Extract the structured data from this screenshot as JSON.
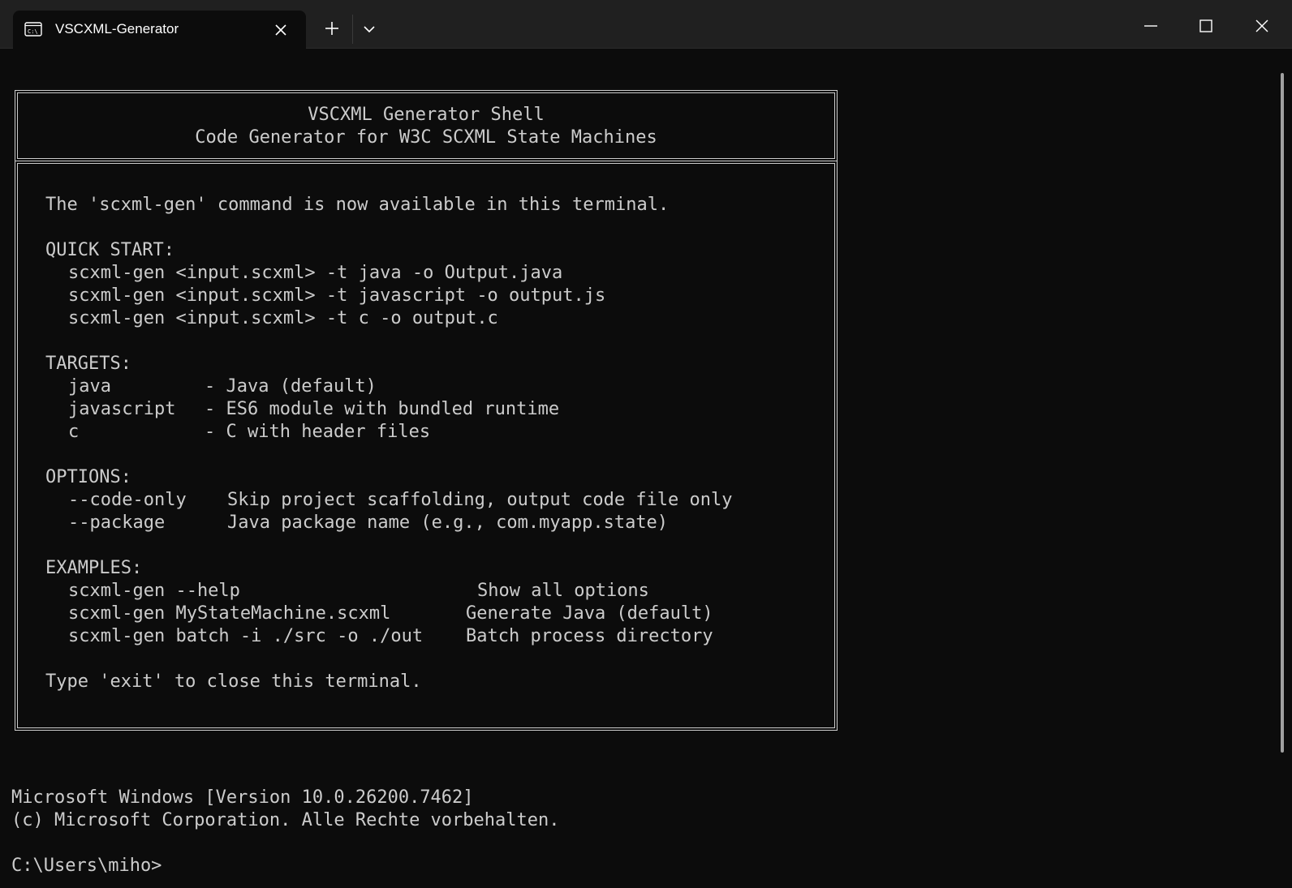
{
  "window": {
    "tab_title": "VSCXML-Generator",
    "icons": {
      "tab_icon": "terminal-icon",
      "tab_close": "close-icon",
      "new_tab": "plus-icon",
      "dropdown": "chevron-down-icon",
      "minimize": "minimize-icon",
      "maximize": "maximize-icon",
      "close": "close-icon"
    }
  },
  "banner": {
    "title": "VSCXML Generator Shell",
    "subtitle": "Code Generator for W3C SCXML State Machines"
  },
  "body": {
    "intro": "The 'scxml-gen' command is now available in this terminal.",
    "quick_start": {
      "heading": "QUICK START:",
      "lines": [
        "scxml-gen <input.scxml> -t java -o Output.java",
        "scxml-gen <input.scxml> -t javascript -o output.js",
        "scxml-gen <input.scxml> -t c -o output.c"
      ]
    },
    "targets": {
      "heading": "TARGETS:",
      "rows": [
        {
          "name": "java",
          "desc": "- Java (default)"
        },
        {
          "name": "javascript",
          "desc": "- ES6 module with bundled runtime"
        },
        {
          "name": "c",
          "desc": "- C with header files"
        }
      ]
    },
    "options": {
      "heading": "OPTIONS:",
      "rows": [
        {
          "name": "--code-only",
          "desc": "Skip project scaffolding, output code file only"
        },
        {
          "name": "--package",
          "desc": "Java package name (e.g., com.myapp.state)"
        }
      ]
    },
    "examples": {
      "heading": "EXAMPLES:",
      "rows": [
        {
          "cmd": "scxml-gen --help",
          "desc": "Show all options"
        },
        {
          "cmd": "scxml-gen MyStateMachine.scxml",
          "desc": "Generate Java (default)"
        },
        {
          "cmd": "scxml-gen batch -i ./src -o ./out",
          "desc": "Batch process directory"
        }
      ]
    },
    "outro": "Type 'exit' to close this terminal."
  },
  "console": {
    "version_line": "Microsoft Windows [Version 10.0.26200.7462]",
    "copyright_line": "(c) Microsoft Corporation. Alle Rechte vorbehalten.",
    "prompt": "C:\\Users\\miho>"
  },
  "colors": {
    "background": "#0c0c0c",
    "titlebar": "#202020",
    "text": "#cccccc"
  }
}
